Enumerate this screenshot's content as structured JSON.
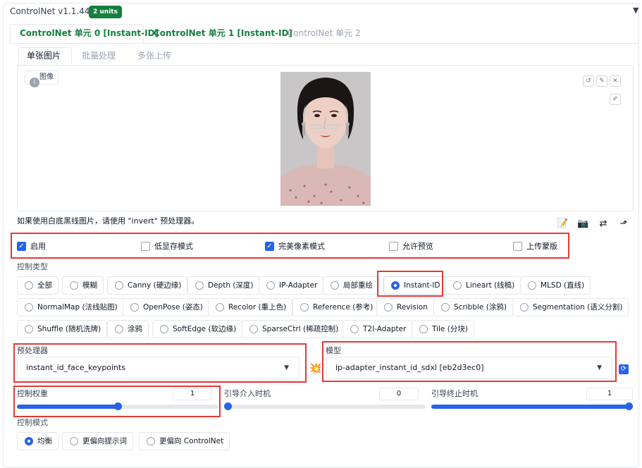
{
  "header": {
    "title": "ControlNet v1.1.444",
    "units_badge": "2 units",
    "collapse_glyph": "▼"
  },
  "unit_tabs": [
    {
      "label": "ControlNet 单元 0 [Instant-ID]",
      "active": true
    },
    {
      "label": "ControlNet 单元 1 [Instant-ID]",
      "active": false
    },
    {
      "label": "ControlNet 单元 2",
      "active": false
    }
  ],
  "input_tabs": [
    {
      "label": "单张图片",
      "active": true
    },
    {
      "label": "批量处理",
      "active": false
    },
    {
      "label": "多张上传",
      "active": false
    }
  ],
  "image_panel": {
    "label": "图像",
    "hint": "如果使用白底黑线图片，请使用 \"invert\" 预处理器。"
  },
  "options": {
    "enable": {
      "label": "启用",
      "checked": true
    },
    "low_vram": {
      "label": "低显存模式",
      "checked": false
    },
    "pixel_perfect": {
      "label": "完美像素模式",
      "checked": true
    },
    "allow_preview": {
      "label": "允许预览",
      "checked": false
    },
    "upload_mask": {
      "label": "上传蒙版",
      "checked": false
    }
  },
  "control_type": {
    "label": "控制类型",
    "selected": "Instant-ID",
    "items": [
      "全部",
      "模糊",
      "Canny (硬边缘)",
      "Depth (深度)",
      "IP-Adapter",
      "局部重绘",
      "Instant-ID",
      "Lineart (线稿)",
      "MLSD (直线)",
      "NormalMap (法线贴图)",
      "OpenPose (姿态)",
      "Recolor (重上色)",
      "Reference (参考)",
      "Revision",
      "Scribble (涂鸦)",
      "Segmentation (语义分割)",
      "Shuffle (随机洗牌)",
      "涂鸦",
      "SoftEdge (软边缘)",
      "SparseCtrl (稀疏控制)",
      "T2I-Adapter",
      "Tile (分块)"
    ]
  },
  "preprocessor": {
    "label": "预处理器",
    "value": "instant_id_face_keypoints"
  },
  "model": {
    "label": "模型",
    "value": "ip-adapter_instant_id_sdxl [eb2d3ec0]"
  },
  "sliders": {
    "weight": {
      "label": "控制权重",
      "value": "1",
      "fraction": 0.5
    },
    "start": {
      "label": "引导介入时机",
      "value": "0",
      "fraction": 0
    },
    "end": {
      "label": "引导终止时机",
      "value": "1",
      "fraction": 1
    }
  },
  "control_mode": {
    "label": "控制模式",
    "items": [
      "均衡",
      "更偏向提示词",
      "更偏向 ControlNet"
    ],
    "selected": "均衡"
  },
  "colors": {
    "accent": "#2563eb",
    "green": "#15803d",
    "highlight_red": "#e53935"
  }
}
